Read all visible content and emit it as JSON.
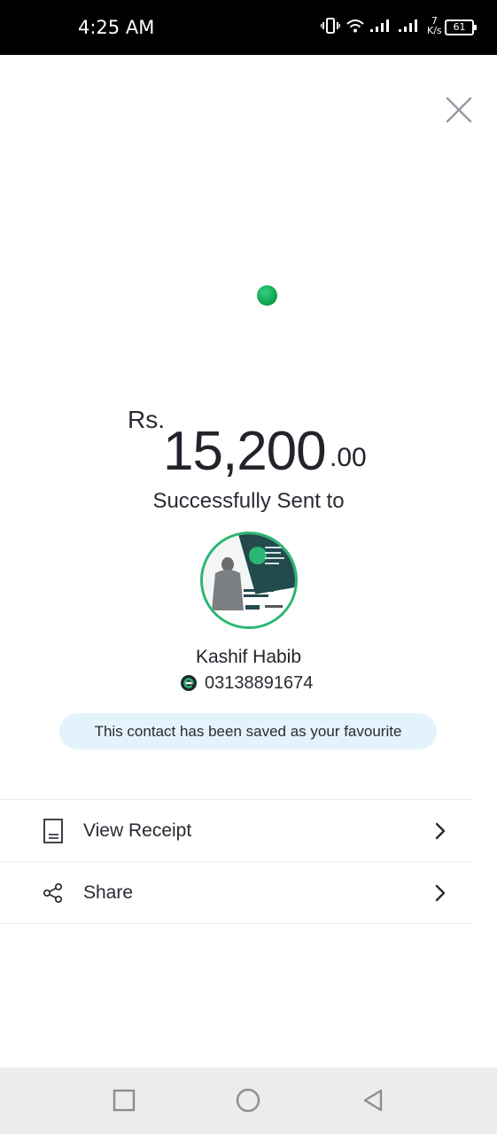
{
  "status_bar": {
    "time": "4:25 AM",
    "net_speed_value": "7",
    "net_speed_unit": "K/s",
    "battery": "61"
  },
  "payment": {
    "currency": "Rs.",
    "amount_main": "15,200",
    "amount_decimal": ".00",
    "status_text": "Successfully Sent to",
    "status_color": "#10a24d"
  },
  "recipient": {
    "name": "Kashif Habib",
    "number": "03138891674",
    "favourite_notice": "This contact has been saved as your favourite"
  },
  "actions": [
    {
      "label": "View Receipt",
      "icon": "receipt-icon"
    },
    {
      "label": "Share",
      "icon": "share-icon"
    }
  ],
  "colors": {
    "accent_green": "#2bb673",
    "banner_bg": "#e4f3fb",
    "nav_bg": "#ececec"
  }
}
